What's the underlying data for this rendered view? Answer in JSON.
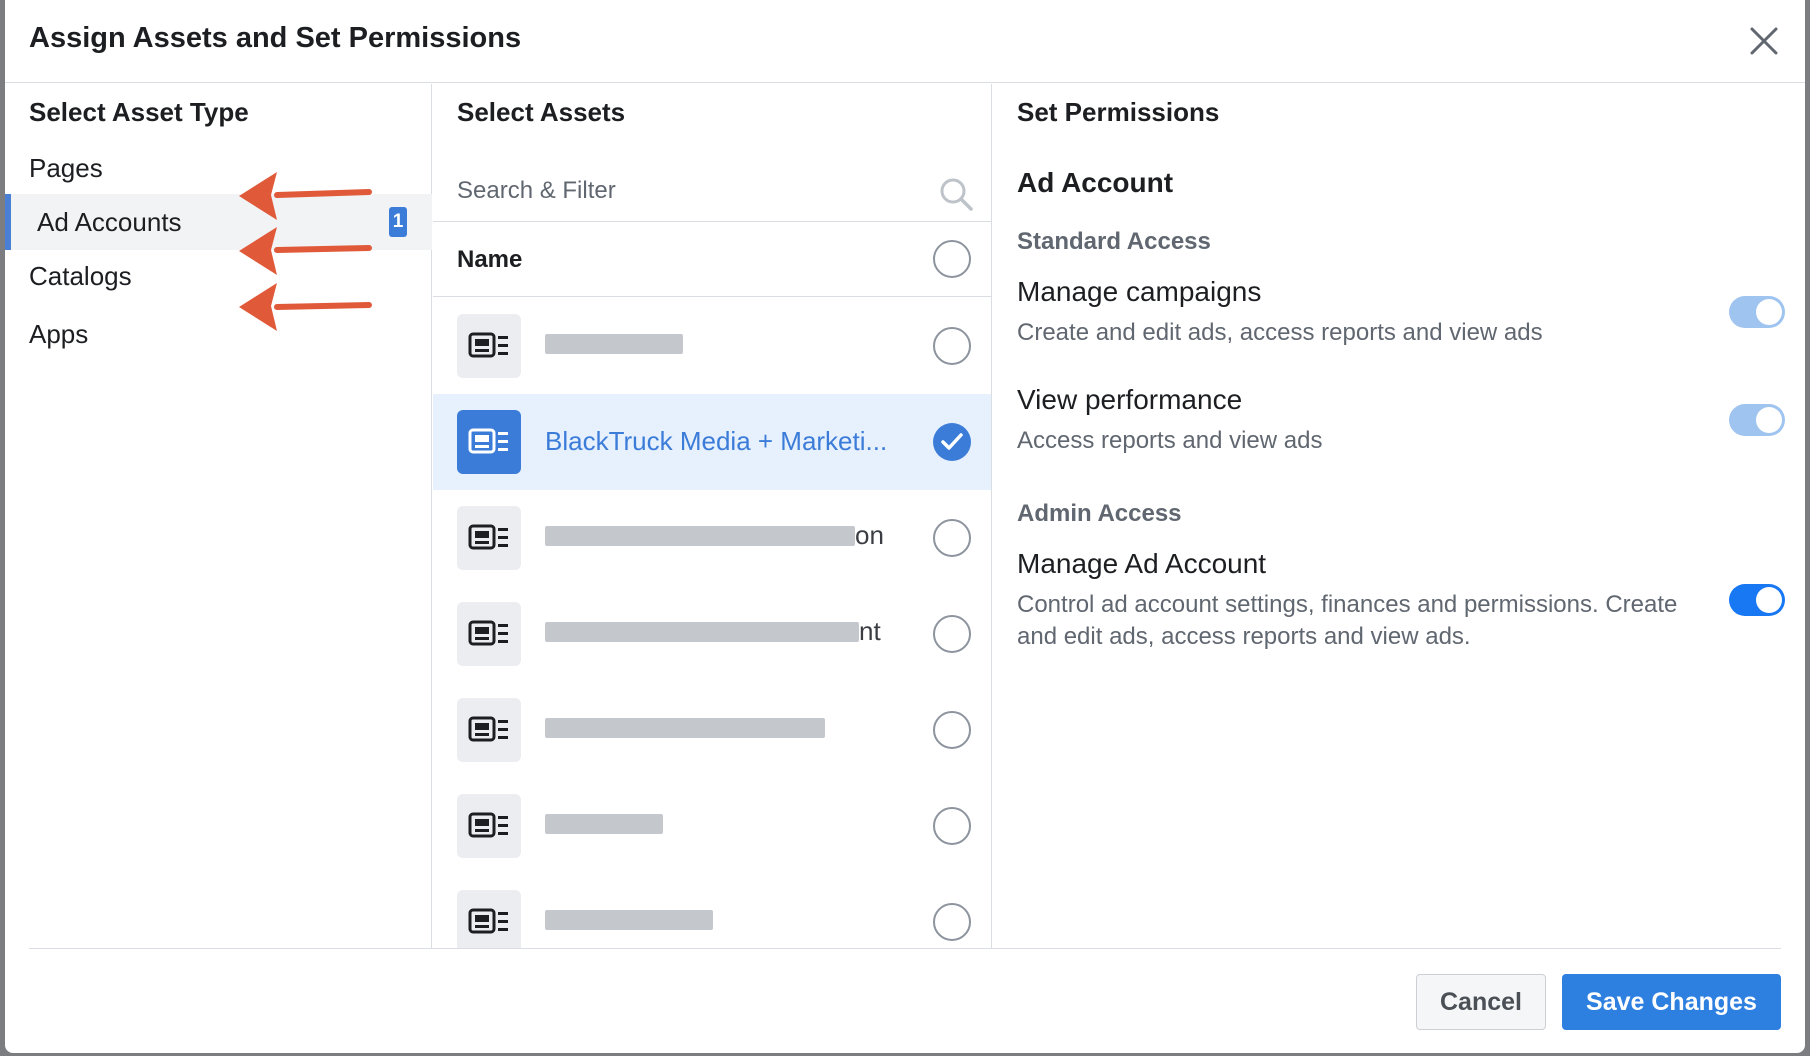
{
  "dialog": {
    "title": "Assign Assets and Set Permissions"
  },
  "asset_types": {
    "heading": "Select Asset Type",
    "items": [
      {
        "label": "Pages",
        "active": false
      },
      {
        "label": "Ad Accounts",
        "active": true,
        "badge": "1"
      },
      {
        "label": "Catalogs",
        "active": false
      },
      {
        "label": "Apps",
        "active": false
      }
    ]
  },
  "assets": {
    "heading": "Select Assets",
    "search_placeholder": "Search & Filter",
    "column_header": "Name",
    "rows": [
      {
        "name": "",
        "blurred": true,
        "selected": false
      },
      {
        "name": "BlackTruck Media + Marketi...",
        "blurred": false,
        "selected": true
      },
      {
        "name": "",
        "visible_suffix": "on",
        "blurred": true,
        "selected": false
      },
      {
        "name": "",
        "visible_suffix": "nt",
        "blurred": true,
        "selected": false
      },
      {
        "name": "",
        "blurred": true,
        "selected": false
      },
      {
        "name": "",
        "blurred": true,
        "selected": false
      },
      {
        "name": "",
        "blurred": true,
        "selected": false
      }
    ]
  },
  "permissions": {
    "heading": "Set Permissions",
    "asset_type_title": "Ad Account",
    "standard_access": {
      "label": "Standard Access",
      "items": [
        {
          "name": "Manage campaigns",
          "description": "Create and edit ads, access reports and view ads",
          "enabled": true,
          "locked": true
        },
        {
          "name": "View performance",
          "description": "Access reports and view ads",
          "enabled": true,
          "locked": true
        }
      ]
    },
    "admin_access": {
      "label": "Admin Access",
      "items": [
        {
          "name": "Manage Ad Account",
          "description": "Control ad account settings, finances and permissions. Create and edit ads, access reports and view ads.",
          "enabled": true,
          "locked": false
        }
      ]
    }
  },
  "footer": {
    "cancel_label": "Cancel",
    "save_label": "Save Changes"
  },
  "colors": {
    "accent_blue": "#1877f2",
    "selected_row_bg": "#e7f0fd",
    "annotation_arrow": "#e05a3a"
  }
}
